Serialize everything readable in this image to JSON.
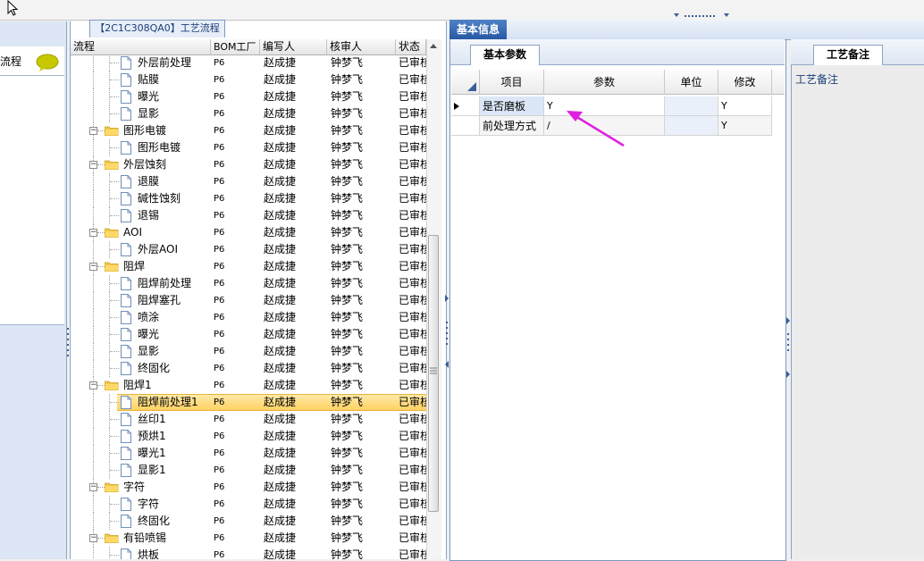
{
  "left_panel": {
    "label": "流程"
  },
  "tree_tab": {
    "label": "【2C1C308QA0】工艺流程"
  },
  "tree_columns": [
    "流程",
    "BOM工厂",
    "编写人",
    "核审人",
    "状态"
  ],
  "tree_rows": [
    {
      "name": "外层前处理",
      "level": 2,
      "type": "doc",
      "bom": "P6",
      "writer": "赵成捷",
      "reviewer": "钟梦飞",
      "status": "已审核"
    },
    {
      "name": "贴膜",
      "level": 2,
      "type": "doc",
      "bom": "P6",
      "writer": "赵成捷",
      "reviewer": "钟梦飞",
      "status": "已审核"
    },
    {
      "name": "曝光",
      "level": 2,
      "type": "doc",
      "bom": "P6",
      "writer": "赵成捷",
      "reviewer": "钟梦飞",
      "status": "已审核"
    },
    {
      "name": "显影",
      "level": 2,
      "type": "doc",
      "bom": "P6",
      "writer": "赵成捷",
      "reviewer": "钟梦飞",
      "status": "已审核"
    },
    {
      "name": "图形电镀",
      "level": 1,
      "type": "folder",
      "bom": "P6",
      "writer": "赵成捷",
      "reviewer": "钟梦飞",
      "status": "已审核"
    },
    {
      "name": "图形电镀",
      "level": 2,
      "type": "doc",
      "bom": "P6",
      "writer": "赵成捷",
      "reviewer": "钟梦飞",
      "status": "已审核"
    },
    {
      "name": "外层蚀刻",
      "level": 1,
      "type": "folder",
      "bom": "P6",
      "writer": "赵成捷",
      "reviewer": "钟梦飞",
      "status": "已审核"
    },
    {
      "name": "退膜",
      "level": 2,
      "type": "doc",
      "bom": "P6",
      "writer": "赵成捷",
      "reviewer": "钟梦飞",
      "status": "已审核"
    },
    {
      "name": "碱性蚀刻",
      "level": 2,
      "type": "doc",
      "bom": "P6",
      "writer": "赵成捷",
      "reviewer": "钟梦飞",
      "status": "已审核"
    },
    {
      "name": "退锡",
      "level": 2,
      "type": "doc",
      "bom": "P6",
      "writer": "赵成捷",
      "reviewer": "钟梦飞",
      "status": "已审核"
    },
    {
      "name": "AOI",
      "level": 1,
      "type": "folder",
      "bom": "P6",
      "writer": "赵成捷",
      "reviewer": "钟梦飞",
      "status": "已审核"
    },
    {
      "name": "外层AOI",
      "level": 2,
      "type": "doc",
      "bom": "P6",
      "writer": "赵成捷",
      "reviewer": "钟梦飞",
      "status": "已审核"
    },
    {
      "name": "阻焊",
      "level": 1,
      "type": "folder",
      "bom": "P6",
      "writer": "赵成捷",
      "reviewer": "钟梦飞",
      "status": "已审核"
    },
    {
      "name": "阻焊前处理",
      "level": 2,
      "type": "doc",
      "bom": "P6",
      "writer": "赵成捷",
      "reviewer": "钟梦飞",
      "status": "已审核"
    },
    {
      "name": "阻焊塞孔",
      "level": 2,
      "type": "doc",
      "bom": "P6",
      "writer": "赵成捷",
      "reviewer": "钟梦飞",
      "status": "已审核"
    },
    {
      "name": "喷涂",
      "level": 2,
      "type": "doc",
      "bom": "P6",
      "writer": "赵成捷",
      "reviewer": "钟梦飞",
      "status": "已审核"
    },
    {
      "name": "曝光",
      "level": 2,
      "type": "doc",
      "bom": "P6",
      "writer": "赵成捷",
      "reviewer": "钟梦飞",
      "status": "已审核"
    },
    {
      "name": "显影",
      "level": 2,
      "type": "doc",
      "bom": "P6",
      "writer": "赵成捷",
      "reviewer": "钟梦飞",
      "status": "已审核"
    },
    {
      "name": "终固化",
      "level": 2,
      "type": "doc",
      "bom": "P6",
      "writer": "赵成捷",
      "reviewer": "钟梦飞",
      "status": "已审核"
    },
    {
      "name": "阻焊1",
      "level": 1,
      "type": "folder",
      "bom": "P6",
      "writer": "赵成捷",
      "reviewer": "钟梦飞",
      "status": "已审核"
    },
    {
      "name": "阻焊前处理1",
      "level": 2,
      "type": "doc",
      "bom": "P6",
      "writer": "赵成捷",
      "reviewer": "钟梦飞",
      "status": "已审核",
      "selected": true
    },
    {
      "name": "丝印1",
      "level": 2,
      "type": "doc",
      "bom": "P6",
      "writer": "赵成捷",
      "reviewer": "钟梦飞",
      "status": "已审核"
    },
    {
      "name": "预烘1",
      "level": 2,
      "type": "doc",
      "bom": "P6",
      "writer": "赵成捷",
      "reviewer": "钟梦飞",
      "status": "已审核"
    },
    {
      "name": "曝光1",
      "level": 2,
      "type": "doc",
      "bom": "P6",
      "writer": "赵成捷",
      "reviewer": "钟梦飞",
      "status": "已审核"
    },
    {
      "name": "显影1",
      "level": 2,
      "type": "doc",
      "bom": "P6",
      "writer": "赵成捷",
      "reviewer": "钟梦飞",
      "status": "已审核"
    },
    {
      "name": "字符",
      "level": 1,
      "type": "folder",
      "bom": "P6",
      "writer": "赵成捷",
      "reviewer": "钟梦飞",
      "status": "已审核"
    },
    {
      "name": "字符",
      "level": 2,
      "type": "doc",
      "bom": "P6",
      "writer": "赵成捷",
      "reviewer": "钟梦飞",
      "status": "已审核"
    },
    {
      "name": "终固化",
      "level": 2,
      "type": "doc",
      "bom": "P6",
      "writer": "赵成捷",
      "reviewer": "钟梦飞",
      "status": "已审核"
    },
    {
      "name": "有铅喷锡",
      "level": 1,
      "type": "folder",
      "bom": "P6",
      "writer": "赵成捷",
      "reviewer": "钟梦飞",
      "status": "已审核"
    },
    {
      "name": "烘板",
      "level": 2,
      "type": "doc",
      "bom": "P6",
      "writer": "赵成捷",
      "reviewer": "钟梦飞",
      "status": "已审核"
    }
  ],
  "info": {
    "tab_label": "基本信息",
    "params_tab": "基本参数",
    "columns": [
      "项目",
      "参数",
      "单位",
      "修改"
    ],
    "rows": [
      {
        "item": "是否磨板",
        "param": "Y",
        "unit": "",
        "modify": "Y",
        "current": true
      },
      {
        "item": "前处理方式",
        "param": "/",
        "unit": "",
        "modify": "Y"
      }
    ]
  },
  "memo": {
    "tab_label": "工艺备注",
    "label": "工艺备注"
  },
  "colors": {
    "accent": "#2858a4",
    "selection": "#ffd262",
    "annotation_arrow": "#e020e0"
  }
}
